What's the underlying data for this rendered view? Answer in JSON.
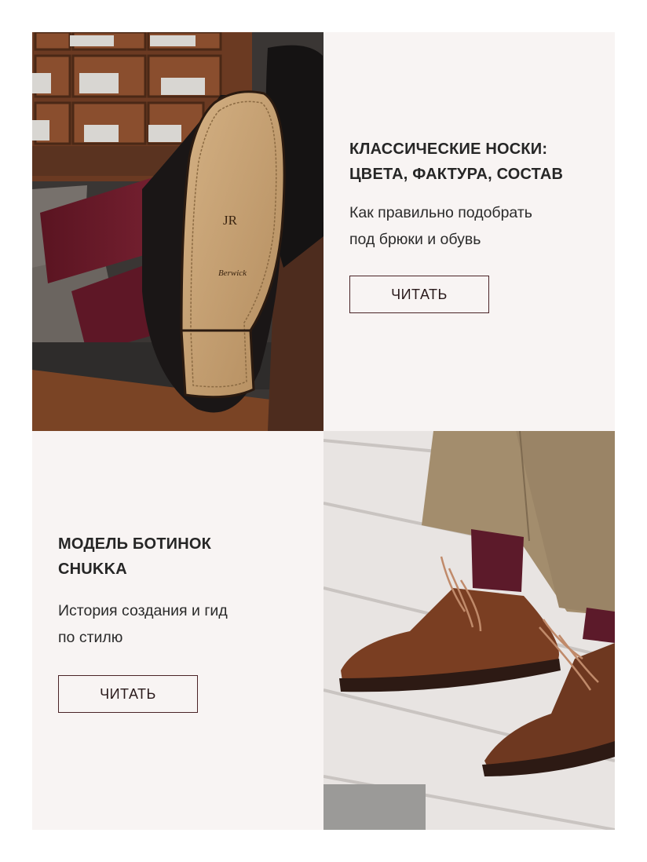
{
  "cards": [
    {
      "title_line1": "КЛАССИЧЕСКИЕ НОСКИ:",
      "title_line2": "ЦВЕТА, ФАКТУРА, СОСТАВ",
      "subtitle_line1": "Как правильно подобрать",
      "subtitle_line2": "под брюки и обувь",
      "button_label": "ЧИТАТЬ"
    },
    {
      "title_line1": "МОДЕЛЬ БОТИНОК",
      "title_line2": "CHUKKA",
      "subtitle_line1": "История создания и гид",
      "subtitle_line2": "по стилю",
      "button_label": "ЧИТАТЬ"
    }
  ],
  "photos": {
    "sole_stamp_monogram": "JR",
    "sole_stamp_brand": "Berwick"
  },
  "colors": {
    "card_background": "#f8f4f3",
    "button_border": "#4a2326",
    "sock_burgundy": "#6a1c2b",
    "suede_brown": "#7a3e22",
    "chino_khaki": "#a38d6d"
  }
}
